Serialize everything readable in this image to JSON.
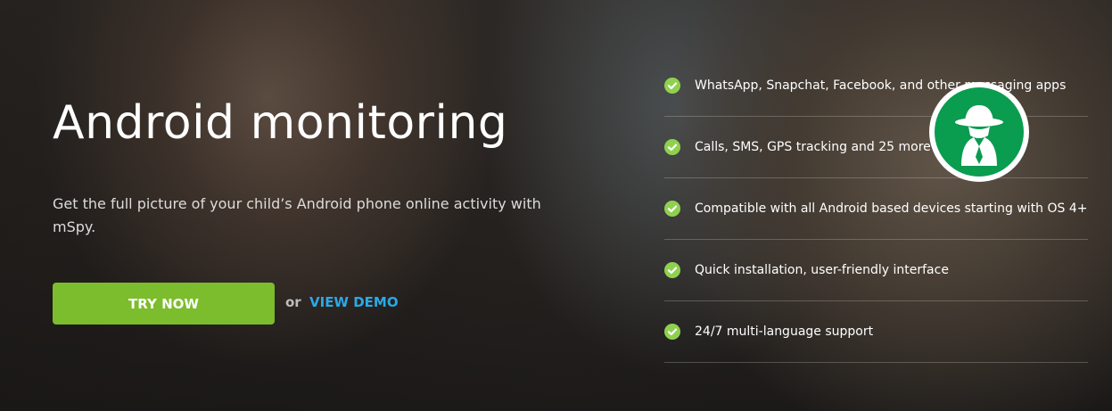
{
  "hero": {
    "title": "Android monitoring",
    "subtitle": "Get the full picture of your child’s Android phone online activity with mSpy.",
    "try_now_label": "TRY NOW",
    "or_label": "or",
    "view_demo_label": "VIEW DEMO"
  },
  "features": [
    {
      "text": "WhatsApp, Snapchat, Facebook, and other messaging apps",
      "icon": "check-circle-icon"
    },
    {
      "text": "Calls, SMS, GPS tracking and 25 more",
      "icon": "check-circle-icon"
    },
    {
      "text": "Compatible with all Android based devices starting with OS 4+",
      "icon": "check-circle-icon"
    },
    {
      "text": "Quick installation, user-friendly interface",
      "icon": "check-circle-icon"
    },
    {
      "text": "24/7 multi-language support",
      "icon": "check-circle-icon"
    }
  ],
  "badge": {
    "icon": "spy-agent-icon"
  },
  "colors": {
    "accent_green": "#7bbd2c",
    "check_green": "#8fd14f",
    "link_blue": "#2ba9e6",
    "badge_green": "#0a9c4f"
  }
}
